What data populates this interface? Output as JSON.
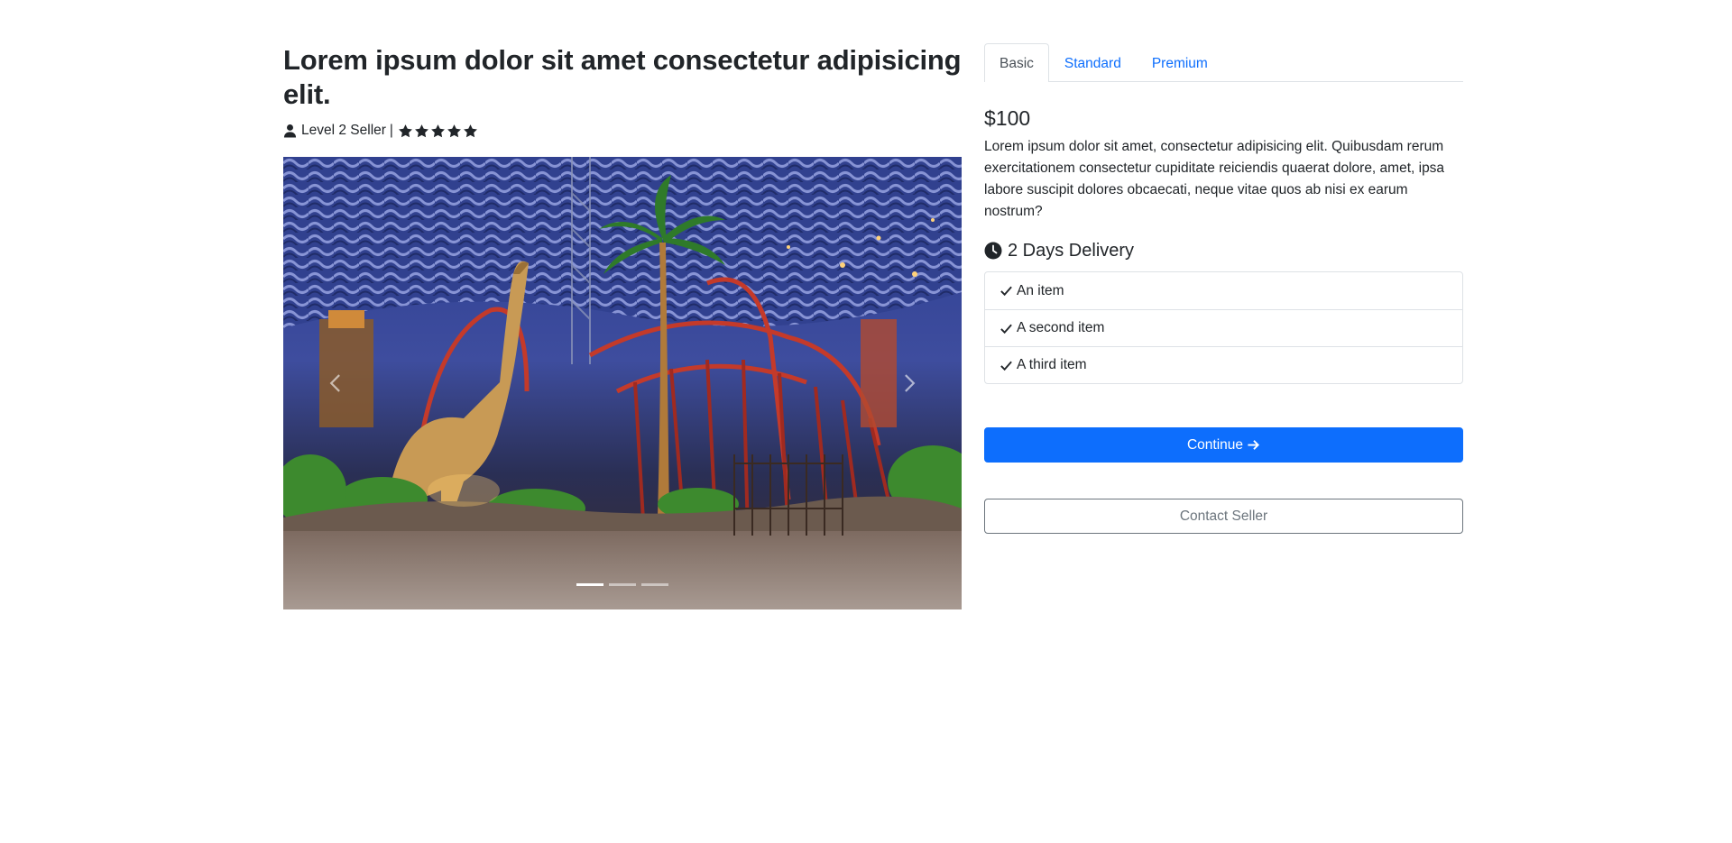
{
  "listing": {
    "title": "Lorem ipsum dolor sit amet consectetur adipisicing elit.",
    "seller_level": "Level 2 Seller",
    "separator": "|",
    "rating_stars": 5
  },
  "carousel": {
    "slides": 3,
    "active_index": 0,
    "prev_icon": "chevron-left-icon",
    "next_icon": "chevron-right-icon"
  },
  "tabs": [
    {
      "label": "Basic",
      "active": true
    },
    {
      "label": "Standard",
      "active": false
    },
    {
      "label": "Premium",
      "active": false
    }
  ],
  "package": {
    "price": "$100",
    "description": "Lorem ipsum dolor sit amet, consectetur adipisicing elit. Quibusdam rerum exercitationem consectetur cupiditate reiciendis quaerat dolore, amet, ipsa labore suscipit dolores obcaecati, neque vitae quos ab nisi ex earum nostrum?",
    "delivery": "2 Days Delivery",
    "features": [
      "An item",
      "A second item",
      "A third item"
    ]
  },
  "actions": {
    "continue_label": "Continue",
    "contact_label": "Contact Seller"
  },
  "colors": {
    "primary": "#0d6efd",
    "text": "#212529",
    "secondary": "#6c757d",
    "border": "#dee2e6"
  }
}
